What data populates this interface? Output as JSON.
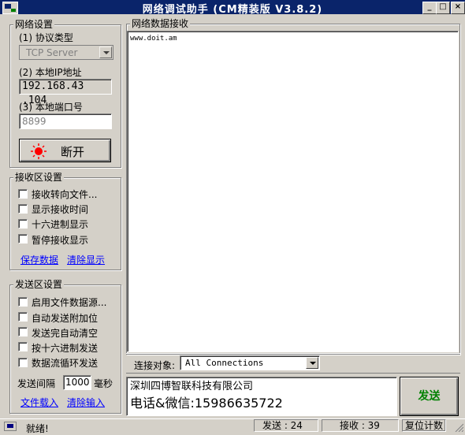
{
  "window": {
    "title": "网络调试助手 (CM精装版 V3.8.2)",
    "minimize": "_",
    "maximize": "□",
    "close": "×"
  },
  "network": {
    "group_title": "网络设置",
    "protocol_label": "(1) 协议类型",
    "protocol_value": "TCP Server",
    "ip_label": "(2) 本地IP地址",
    "ip_value": "192.168.43 .104",
    "port_label": "(3) 本地端口号",
    "port_value": "8899",
    "disconnect_label": "断开"
  },
  "receive": {
    "group_title": "接收区设置",
    "options": [
      "接收转向文件...",
      "显示接收时间",
      "十六进制显示",
      "暂停接收显示"
    ],
    "save_link": "保存数据",
    "clear_link": "清除显示"
  },
  "send": {
    "group_title": "发送区设置",
    "options": [
      "启用文件数据源...",
      "自动发送附加位",
      "发送完自动清空",
      "按十六进制发送",
      "数据流循环发送"
    ],
    "interval_label": "发送间隔",
    "interval_value": "1000",
    "interval_unit": "毫秒",
    "load_link": "文件载入",
    "clear_link": "清除输入"
  },
  "data_area": {
    "group_title": "网络数据接收",
    "content": "www.doit.am"
  },
  "target": {
    "label": "连接对象:",
    "value": "All Connections"
  },
  "send_input": {
    "line1": "深圳四博智联科技有限公司",
    "line2": "电话&微信:15986635722"
  },
  "send_button": "发送",
  "colors": {
    "send_button_text": "#008000",
    "indicator_red": "#ff0000",
    "link": "#0000ff"
  },
  "status": {
    "ready": "就绪!",
    "sent": "发送 : 24",
    "received": "接收 : 39",
    "reset": "复位计数"
  }
}
